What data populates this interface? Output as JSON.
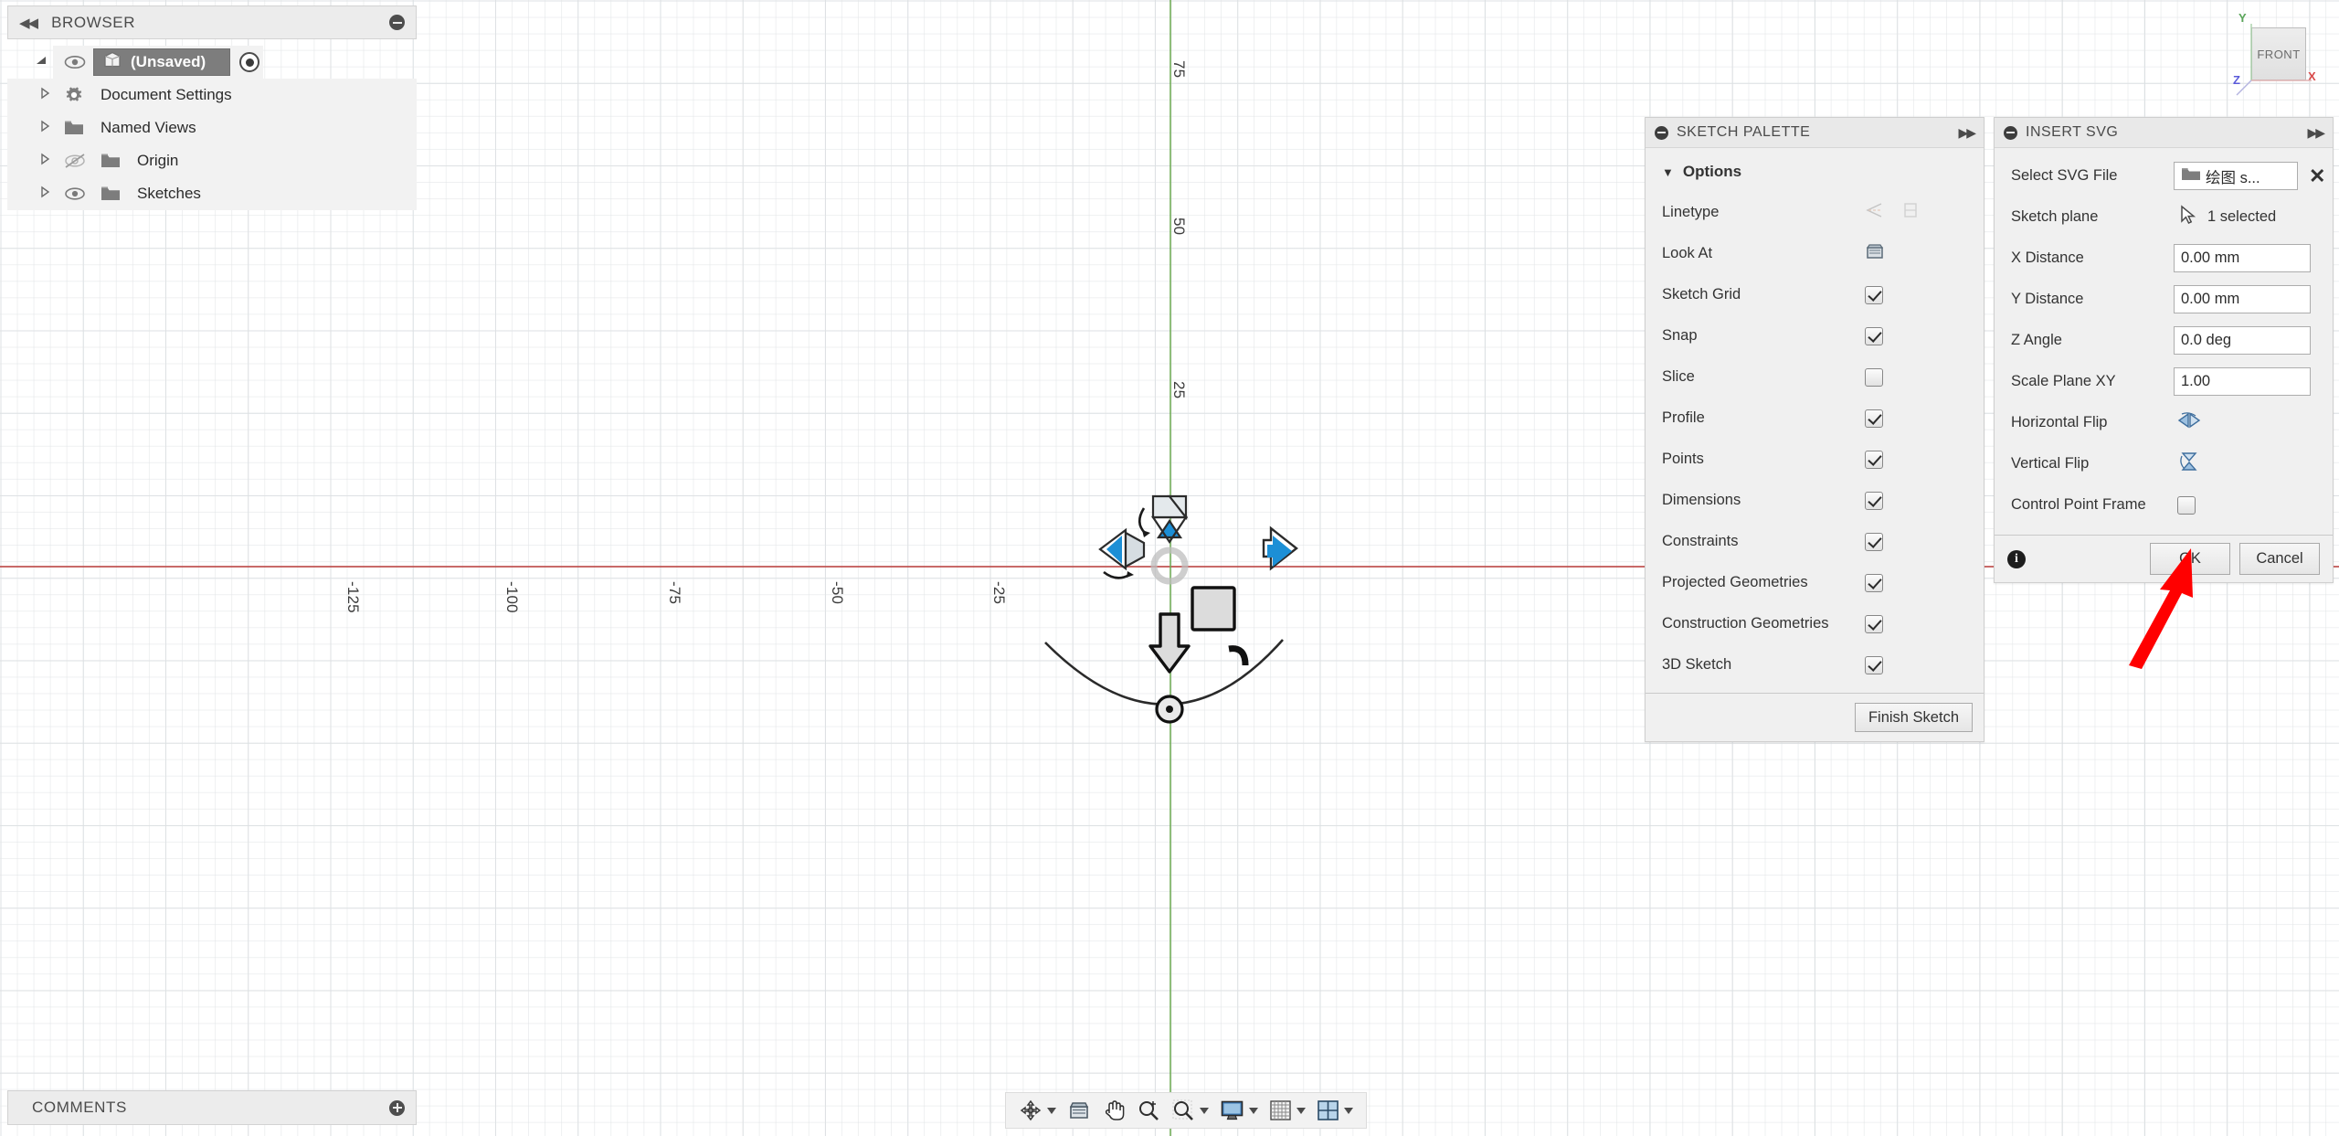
{
  "browser": {
    "bar_title": "BROWSER",
    "collapse_icon": "double-chevron-left-icon",
    "minimize_icon": "minus-circle-icon",
    "root": {
      "label": "(Unsaved)",
      "icon": "component-cube-icon",
      "visible_icon": "eye-icon",
      "activate_icon": "radio-dot-icon",
      "twisty": "▲"
    },
    "items": [
      {
        "label": "Document Settings",
        "icon": "gear-icon",
        "twisty": "▷",
        "eye": "none"
      },
      {
        "label": "Named Views",
        "icon": "folder-icon",
        "twisty": "▷",
        "eye": "none"
      },
      {
        "label": "Origin",
        "icon": "folder-icon",
        "twisty": "▷",
        "eye": "eye-hidden-icon"
      },
      {
        "label": "Sketches",
        "icon": "folder-icon",
        "twisty": "▷",
        "eye": "eye-icon"
      }
    ]
  },
  "comments": {
    "bar_title": "COMMENTS",
    "add_icon": "plus-circle-icon"
  },
  "sketch_palette": {
    "title": "SKETCH PALETTE",
    "minimize_icon": "minus-circle-icon",
    "expand_icon": "double-chevron-right-icon",
    "section_label": "Options",
    "section_caret": "▼",
    "rows": [
      {
        "label": "Linetype",
        "control": "icons",
        "icons": [
          "construction-line-icon",
          "centerline-icon"
        ],
        "disabled": true
      },
      {
        "label": "Look At",
        "control": "icon",
        "icons": [
          "look-at-icon"
        ]
      },
      {
        "label": "Sketch Grid",
        "control": "checkbox",
        "checked": true
      },
      {
        "label": "Snap",
        "control": "checkbox",
        "checked": true
      },
      {
        "label": "Slice",
        "control": "checkbox",
        "checked": false
      },
      {
        "label": "Profile",
        "control": "checkbox",
        "checked": true
      },
      {
        "label": "Points",
        "control": "checkbox",
        "checked": true
      },
      {
        "label": "Dimensions",
        "control": "checkbox",
        "checked": true
      },
      {
        "label": "Constraints",
        "control": "checkbox",
        "checked": true
      },
      {
        "label": "Projected Geometries",
        "control": "checkbox",
        "checked": true
      },
      {
        "label": "Construction Geometries",
        "control": "checkbox",
        "checked": true
      },
      {
        "label": "3D Sketch",
        "control": "checkbox",
        "checked": true
      }
    ],
    "finish_button": "Finish Sketch"
  },
  "insert_svg": {
    "title": "INSERT SVG",
    "minimize_icon": "minus-circle-icon",
    "expand_icon": "double-chevron-right-icon",
    "rows": [
      {
        "label": "Select SVG File",
        "control": "file",
        "value": "绘图 s...",
        "icon": "folder-icon",
        "clear_icon": "close-x-icon"
      },
      {
        "label": "Sketch plane",
        "control": "select",
        "value": "1 selected",
        "icon": "cursor-arrow-icon"
      },
      {
        "label": "X Distance",
        "control": "input",
        "value": "0.00 mm"
      },
      {
        "label": "Y Distance",
        "control": "input",
        "value": "0.00 mm"
      },
      {
        "label": "Z Angle",
        "control": "input",
        "value": "0.0 deg"
      },
      {
        "label": "Scale Plane XY",
        "control": "input",
        "value": "1.00"
      },
      {
        "label": "Horizontal Flip",
        "control": "icon",
        "icon": "horizontal-flip-icon"
      },
      {
        "label": "Vertical Flip",
        "control": "icon",
        "icon": "vertical-flip-icon"
      },
      {
        "label": "Control Point Frame",
        "control": "checkbox",
        "checked": false
      }
    ],
    "info_icon": "info-icon",
    "ok_label": "OK",
    "cancel_label": "Cancel"
  },
  "viewcube": {
    "face_label": "FRONT",
    "axis_x": "X",
    "axis_y": "Y",
    "axis_z": "Z",
    "color_x": "#d94a4a",
    "color_y": "#5aa55a",
    "color_z": "#5a5ad9"
  },
  "nav_toolbar": {
    "items": [
      {
        "name": "orbit-icon",
        "has_dropdown": true
      },
      {
        "name": "look-at-icon",
        "has_dropdown": false
      },
      {
        "name": "pan-hand-icon",
        "has_dropdown": false
      },
      {
        "name": "zoom-magnifier-icon",
        "has_dropdown": false
      },
      {
        "name": "zoom-fit-icon",
        "has_dropdown": true
      },
      {
        "name": "display-settings-icon",
        "has_dropdown": true
      },
      {
        "name": "grid-snaps-icon",
        "has_dropdown": true
      },
      {
        "name": "viewports-icon",
        "has_dropdown": true
      }
    ]
  },
  "canvas": {
    "x_ticks": [
      "-125",
      "-100",
      "-75",
      "-50",
      "-25"
    ],
    "y_ticks": [
      "75",
      "50",
      "25"
    ],
    "axis_x_color": "#c0504d",
    "axis_y_color": "#6aa84f",
    "manipulator_accent": "#1c8fd6",
    "annotation_arrow_color": "#ff0000"
  }
}
